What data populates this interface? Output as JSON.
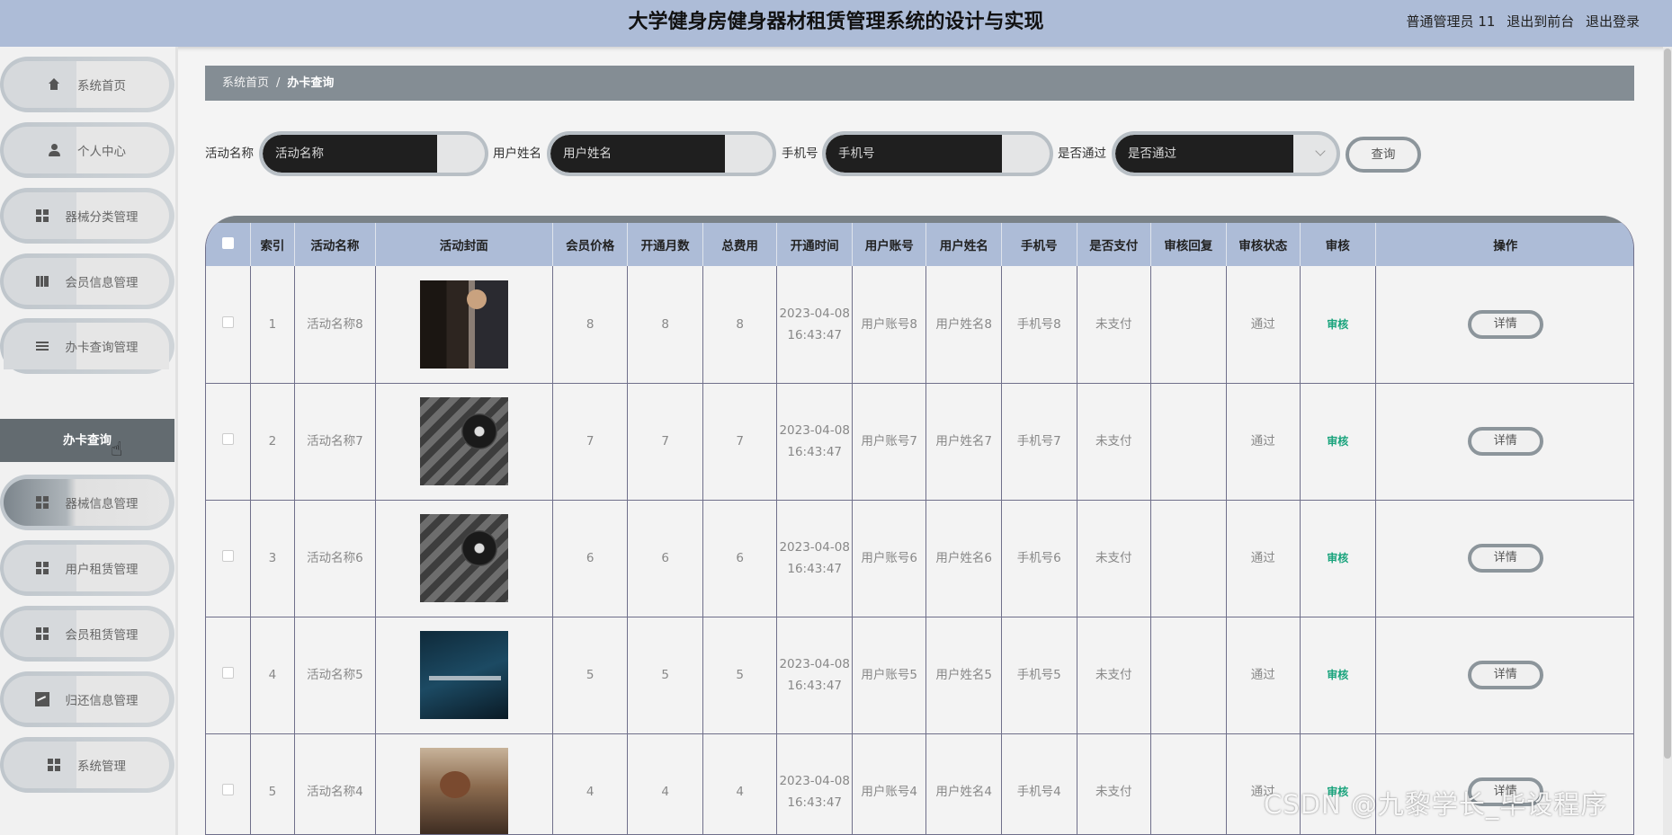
{
  "header": {
    "title": "大学健身房健身器材租赁管理系统的设计与实现",
    "user": "普通管理员 11",
    "to_front": "退出到前台",
    "logout": "退出登录"
  },
  "sidebar": {
    "items": [
      {
        "label": "系统首页",
        "icon": "home-icon"
      },
      {
        "label": "个人中心",
        "icon": "user-icon"
      },
      {
        "label": "器械分类管理",
        "icon": "grid-icon"
      },
      {
        "label": "会员信息管理",
        "icon": "book-icon"
      },
      {
        "label": "办卡查询管理",
        "icon": "list-icon"
      },
      {
        "label": "器械信息管理",
        "icon": "grid-icon"
      },
      {
        "label": "用户租赁管理",
        "icon": "grid-icon"
      },
      {
        "label": "会员租赁管理",
        "icon": "grid-icon"
      },
      {
        "label": "归还信息管理",
        "icon": "chart-icon"
      },
      {
        "label": "系统管理",
        "icon": "grid-icon"
      }
    ],
    "submenu": {
      "label": "办卡查询"
    }
  },
  "breadcrumb": {
    "home": "系统首页",
    "separator": "/",
    "current": "办卡查询"
  },
  "search": {
    "activity_label": "活动名称",
    "activity_placeholder": "活动名称",
    "username_label": "用户姓名",
    "username_placeholder": "用户姓名",
    "phone_label": "手机号",
    "phone_placeholder": "手机号",
    "passed_label": "是否通过",
    "passed_placeholder": "是否通过",
    "query_button": "查询"
  },
  "table": {
    "headers": [
      "索引",
      "活动名称",
      "活动封面",
      "会员价格",
      "开通月数",
      "总费用",
      "开通时间",
      "用户账号",
      "用户姓名",
      "手机号",
      "是否支付",
      "审核回复",
      "审核状态",
      "审核",
      "操作"
    ],
    "rows": [
      {
        "index": "1",
        "name": "活动名称8",
        "price": "8",
        "months": "8",
        "total": "8",
        "time": "2023-04-08 16:43:47",
        "account": "用户账号8",
        "username": "用户姓名8",
        "phone": "手机号8",
        "paid": "未支付",
        "reply": "",
        "status": "通过",
        "review": "审核",
        "action": "详情"
      },
      {
        "index": "2",
        "name": "活动名称7",
        "price": "7",
        "months": "7",
        "total": "7",
        "time": "2023-04-08 16:43:47",
        "account": "用户账号7",
        "username": "用户姓名7",
        "phone": "手机号7",
        "paid": "未支付",
        "reply": "",
        "status": "通过",
        "review": "审核",
        "action": "详情"
      },
      {
        "index": "3",
        "name": "活动名称6",
        "price": "6",
        "months": "6",
        "total": "6",
        "time": "2023-04-08 16:43:47",
        "account": "用户账号6",
        "username": "用户姓名6",
        "phone": "手机号6",
        "paid": "未支付",
        "reply": "",
        "status": "通过",
        "review": "审核",
        "action": "详情"
      },
      {
        "index": "4",
        "name": "活动名称5",
        "price": "5",
        "months": "5",
        "total": "5",
        "time": "2023-04-08 16:43:47",
        "account": "用户账号5",
        "username": "用户姓名5",
        "phone": "手机号5",
        "paid": "未支付",
        "reply": "",
        "status": "通过",
        "review": "审核",
        "action": "详情"
      },
      {
        "index": "5",
        "name": "活动名称4",
        "price": "4",
        "months": "4",
        "total": "4",
        "time": "2023-04-08 16:43:47",
        "account": "用户账号4",
        "username": "用户姓名4",
        "phone": "手机号4",
        "paid": "未支付",
        "reply": "",
        "status": "通过",
        "review": "审核",
        "action": "详情"
      }
    ]
  },
  "watermark": "CSDN @九黎学长_毕设程序",
  "colors": {
    "header_bg": "#adbcd7",
    "breadcrumb_bg": "#848d94",
    "submenu_bg": "#636b70",
    "review_link": "#19a37c"
  }
}
